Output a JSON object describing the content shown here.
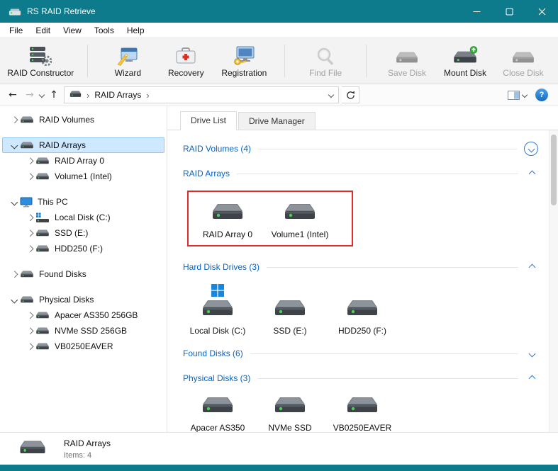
{
  "window": {
    "title": "RS RAID Retrieve"
  },
  "menu": {
    "items": [
      "File",
      "Edit",
      "View",
      "Tools",
      "Help"
    ]
  },
  "toolbar": {
    "buttons": [
      {
        "label": "RAID Constructor",
        "icon": "raid-constructor",
        "enabled": true,
        "separator_before": false
      },
      {
        "label": "Wizard",
        "icon": "wizard",
        "enabled": true,
        "separator_before": true
      },
      {
        "label": "Recovery",
        "icon": "recovery",
        "enabled": true,
        "separator_before": false
      },
      {
        "label": "Registration",
        "icon": "registration",
        "enabled": true,
        "separator_before": false
      },
      {
        "label": "Find File",
        "icon": "find-file",
        "enabled": false,
        "separator_before": true
      },
      {
        "label": "Save Disk",
        "icon": "save-disk",
        "enabled": false,
        "separator_before": true
      },
      {
        "label": "Mount Disk",
        "icon": "mount-disk",
        "enabled": true,
        "separator_before": false
      },
      {
        "label": "Close Disk",
        "icon": "close-disk",
        "enabled": false,
        "separator_before": false
      }
    ]
  },
  "addressbar": {
    "path": "RAID Arrays",
    "help_label": "?"
  },
  "sidebar": {
    "items": [
      {
        "label": "RAID Volumes",
        "level": 0,
        "chevron": "right",
        "icon": "drive",
        "selected": false,
        "group_start": false
      },
      {
        "label": "RAID Arrays",
        "level": 0,
        "chevron": "down",
        "icon": "drive",
        "selected": true,
        "group_start": true
      },
      {
        "label": "RAID Array 0",
        "level": 1,
        "chevron": "right",
        "icon": "drive",
        "selected": false,
        "group_start": false
      },
      {
        "label": "Volume1 (Intel)",
        "level": 1,
        "chevron": "right",
        "icon": "drive",
        "selected": false,
        "group_start": false
      },
      {
        "label": "This PC",
        "level": 0,
        "chevron": "down",
        "icon": "pc",
        "selected": false,
        "group_start": true
      },
      {
        "label": "Local Disk (C:)",
        "level": 1,
        "chevron": "right",
        "icon": "drive-os",
        "selected": false,
        "group_start": false
      },
      {
        "label": "SSD (E:)",
        "level": 1,
        "chevron": "right",
        "icon": "drive",
        "selected": false,
        "group_start": false
      },
      {
        "label": "HDD250 (F:)",
        "level": 1,
        "chevron": "right",
        "icon": "drive",
        "selected": false,
        "group_start": false
      },
      {
        "label": "Found Disks",
        "level": 0,
        "chevron": "right",
        "icon": "drive",
        "selected": false,
        "group_start": true
      },
      {
        "label": "Physical Disks",
        "level": 0,
        "chevron": "down",
        "icon": "drive",
        "selected": false,
        "group_start": true
      },
      {
        "label": "Apacer AS350 256GB",
        "level": 1,
        "chevron": "right",
        "icon": "drive",
        "selected": false,
        "group_start": false
      },
      {
        "label": "NVMe SSD 256GB",
        "level": 1,
        "chevron": "right",
        "icon": "drive",
        "selected": false,
        "group_start": false
      },
      {
        "label": "VB0250EAVER",
        "level": 1,
        "chevron": "right",
        "icon": "drive",
        "selected": false,
        "group_start": false
      }
    ]
  },
  "content": {
    "tabs": [
      {
        "label": "Drive List",
        "active": true
      },
      {
        "label": "Drive Manager",
        "active": false
      }
    ],
    "sections": [
      {
        "title": "RAID Volumes (4)",
        "state": "collapsed",
        "chevron": "circled-down",
        "highlighted": false,
        "items": []
      },
      {
        "title": "RAID Arrays",
        "state": "expanded",
        "chevron": "up",
        "highlighted": true,
        "items": [
          {
            "label": "RAID Array 0",
            "icon": "drive"
          },
          {
            "label": "Volume1 (Intel)",
            "icon": "drive"
          }
        ]
      },
      {
        "title": "Hard Disk Drives (3)",
        "state": "expanded",
        "chevron": "up",
        "highlighted": false,
        "items": [
          {
            "label": "Local Disk (C:)",
            "icon": "drive-os"
          },
          {
            "label": "SSD (E:)",
            "icon": "drive"
          },
          {
            "label": "HDD250 (F:)",
            "icon": "drive"
          }
        ]
      },
      {
        "title": "Found Disks (6)",
        "state": "collapsed",
        "chevron": "down",
        "highlighted": false,
        "items": []
      },
      {
        "title": "Physical Disks (3)",
        "state": "expanded",
        "chevron": "up",
        "highlighted": false,
        "items": [
          {
            "label": "Apacer AS350",
            "icon": "drive"
          },
          {
            "label": "NVMe SSD",
            "icon": "drive"
          },
          {
            "label": "VB0250EAVER",
            "icon": "drive"
          }
        ]
      }
    ]
  },
  "statusbar": {
    "title": "RAID Arrays",
    "items_text": "Items: 4"
  }
}
